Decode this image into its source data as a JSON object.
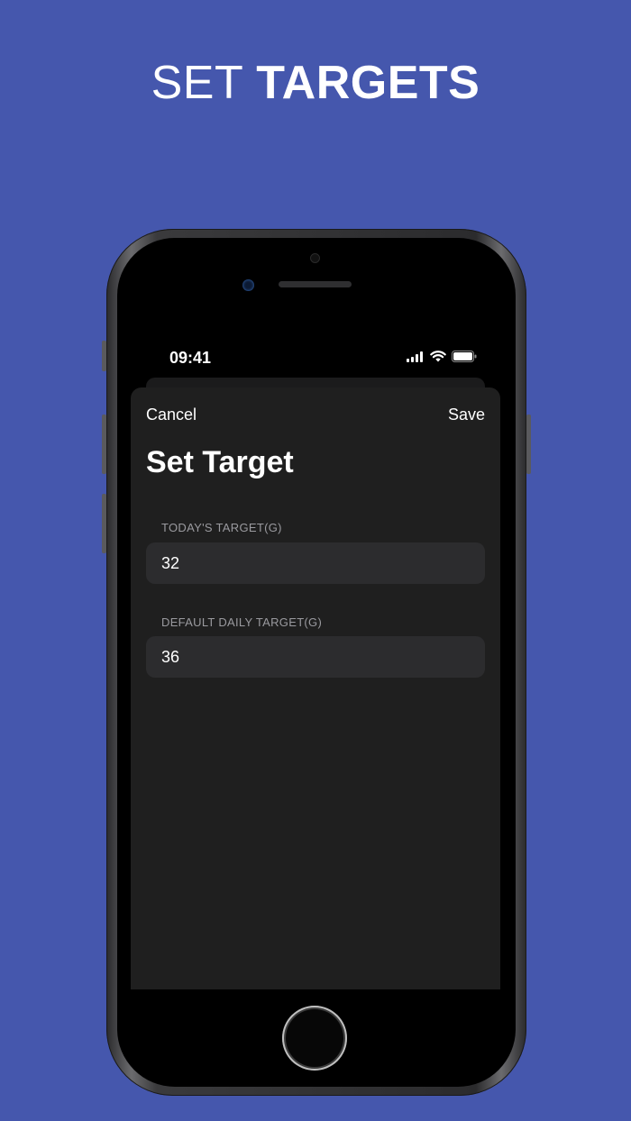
{
  "headline": {
    "light": "SET",
    "bold": "TARGETS"
  },
  "status": {
    "time": "09:41"
  },
  "nav": {
    "cancel_label": "Cancel",
    "save_label": "Save"
  },
  "page": {
    "title": "Set Target"
  },
  "fields": [
    {
      "label": "TODAY'S TARGET(G)",
      "value": "32"
    },
    {
      "label": "DEFAULT DAILY TARGET(G)",
      "value": "36"
    }
  ],
  "colors": {
    "background": "#4557ad",
    "sheet": "#1f1f1f",
    "field": "#2c2c2e"
  },
  "icons": [
    "cellular-signal-icon",
    "wifi-icon",
    "battery-icon"
  ]
}
